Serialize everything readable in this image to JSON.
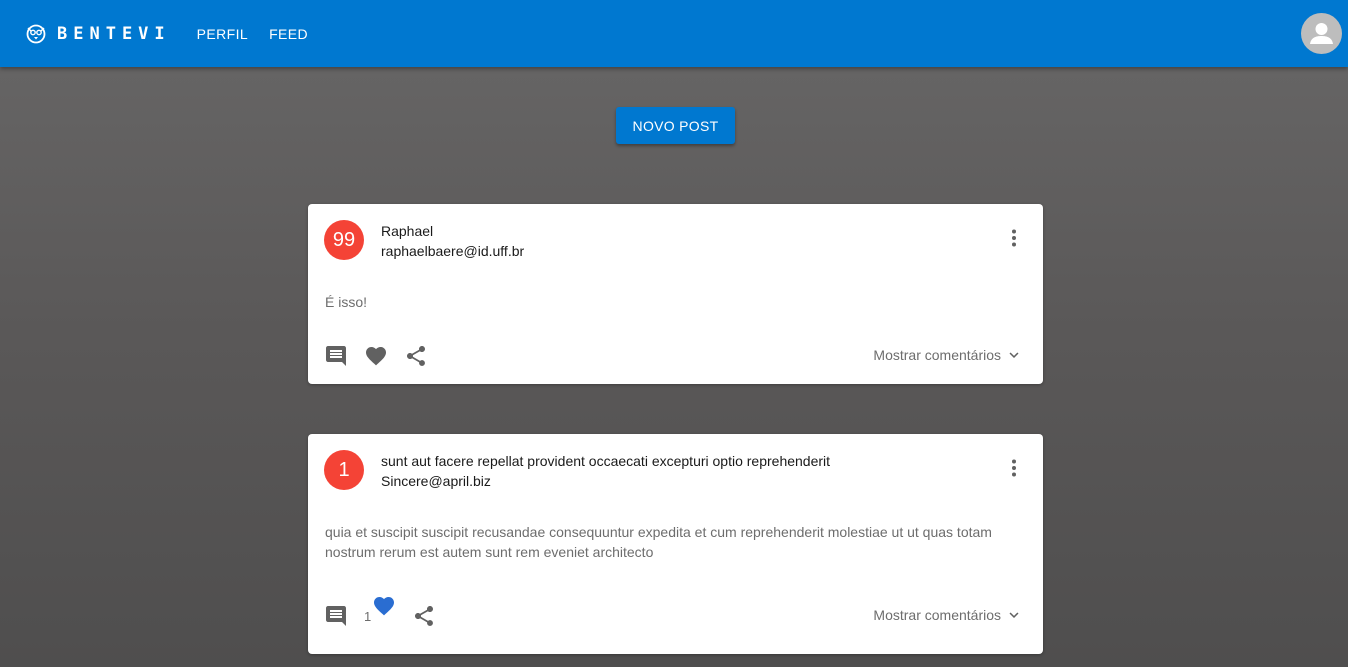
{
  "header": {
    "brand": "BENTEVI",
    "nav": [
      "PERFIL",
      "FEED"
    ]
  },
  "actions": {
    "new_post": "NOVO POST"
  },
  "colors": {
    "primary": "#0078d0",
    "avatar": "#f44336",
    "like_active": "#2a6dd1"
  },
  "posts": [
    {
      "avatar": "99",
      "title": "Raphael",
      "subheader": "raphaelbaere@id.uff.br",
      "body": "É isso!",
      "likes": "",
      "liked": false,
      "show_comments": "Mostrar comentários"
    },
    {
      "avatar": "1",
      "title": "sunt aut facere repellat provident occaecati excepturi optio reprehenderit",
      "subheader": "Sincere@april.biz",
      "body": "quia et suscipit suscipit recusandae consequuntur expedita et cum reprehenderit molestiae ut ut quas totam nostrum rerum est autem sunt rem eveniet architecto",
      "likes": "1",
      "liked": true,
      "show_comments": "Mostrar comentários"
    }
  ],
  "icons": [
    "logo-icon",
    "account-icon",
    "more-vert-icon",
    "comment-icon",
    "heart-icon",
    "share-icon",
    "chevron-down-icon"
  ]
}
